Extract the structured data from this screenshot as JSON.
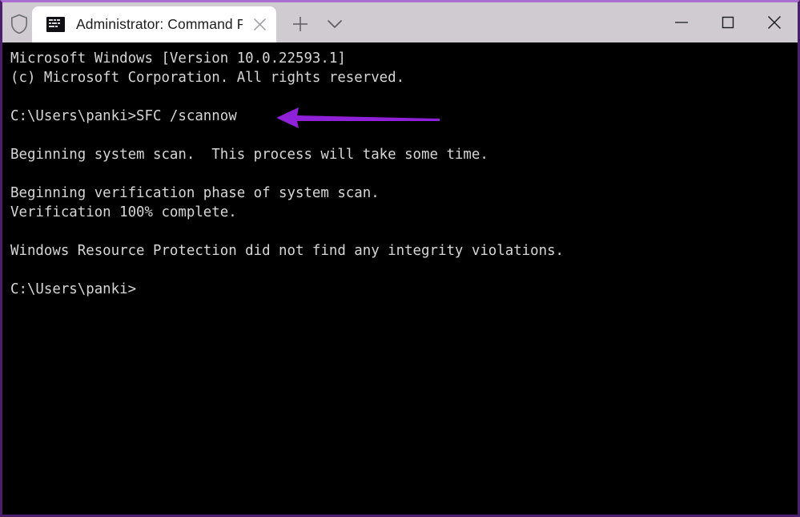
{
  "window": {
    "accent_color": "#a96fd0",
    "border_color": "#4a1f6b",
    "titlebar_bg": "#cfcbd1",
    "terminal_bg": "#000000",
    "terminal_fg": "#d6d6d6"
  },
  "titlebar": {
    "shield_icon": "shield-icon",
    "tab": {
      "icon": "console-icon",
      "title": "Administrator: Command Prom",
      "close_icon": "close-icon"
    },
    "new_tab_icon": "plus-icon",
    "dropdown_icon": "chevron-down-icon",
    "controls": {
      "minimize_icon": "minimize-icon",
      "maximize_icon": "maximize-icon",
      "close_icon": "close-icon"
    }
  },
  "terminal": {
    "lines": [
      "Microsoft Windows [Version 10.0.22593.1]",
      "(c) Microsoft Corporation. All rights reserved.",
      "",
      "C:\\Users\\panki>SFC /scannow",
      "",
      "Beginning system scan.  This process will take some time.",
      "",
      "Beginning verification phase of system scan.",
      "Verification 100% complete.",
      "",
      "Windows Resource Protection did not find any integrity violations.",
      "",
      "C:\\Users\\panki>"
    ]
  },
  "annotation": {
    "arrow_color": "#8f21d8",
    "arrow_direction": "left",
    "points_at": "SFC /scannow"
  }
}
